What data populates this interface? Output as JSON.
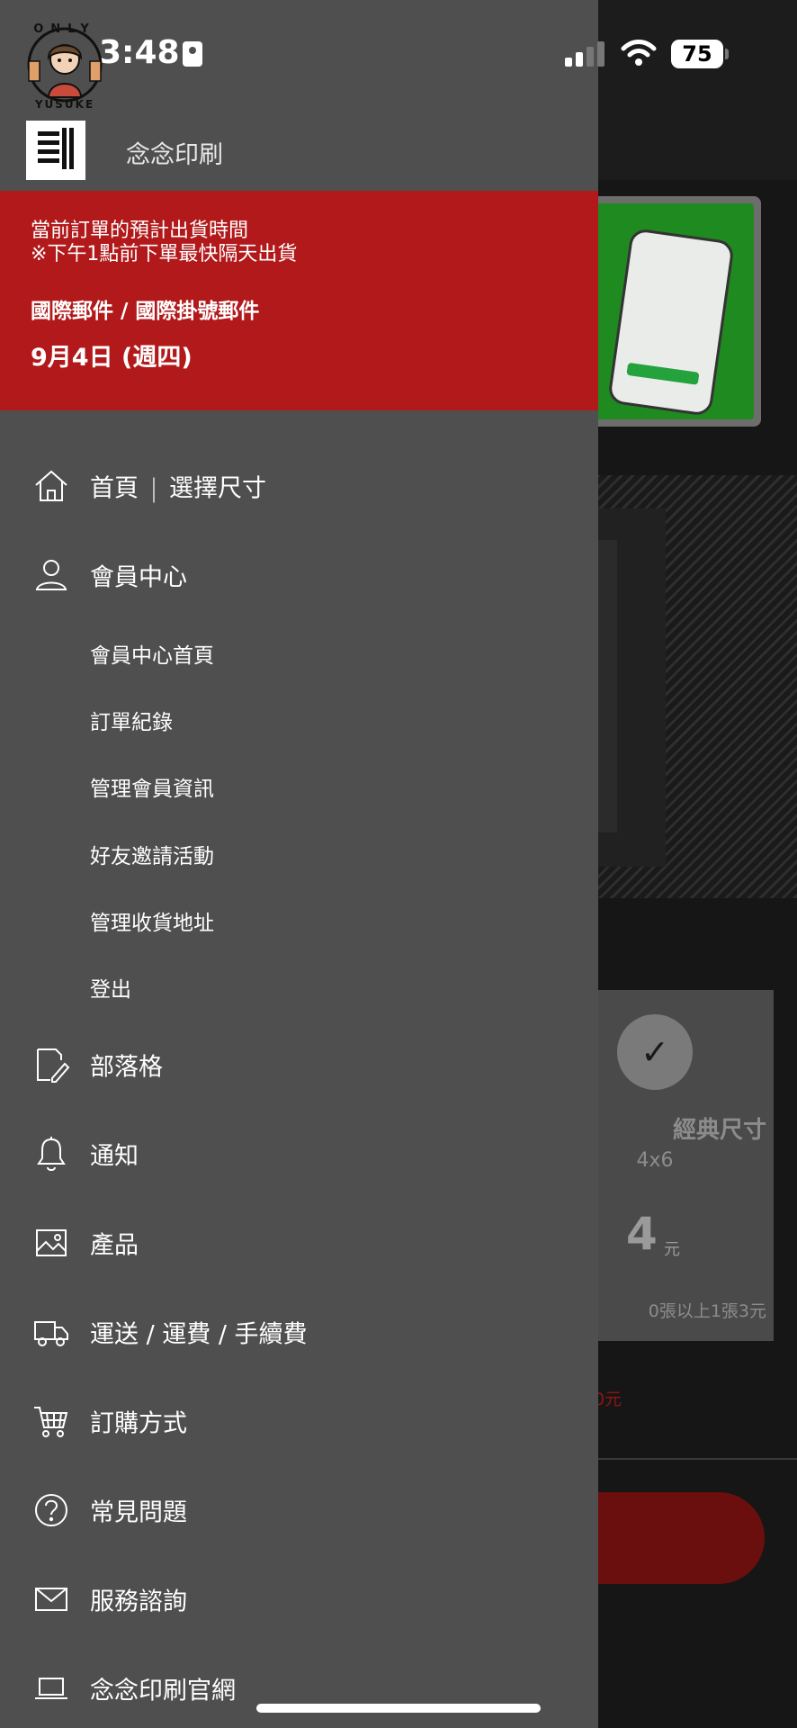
{
  "status_bar": {
    "time": "3:48",
    "battery": "75"
  },
  "watermark": {
    "top_text": "ONLY",
    "bottom_text": "YUSUKE"
  },
  "brand": {
    "name": "念念印刷"
  },
  "shipping": {
    "line1": "當前訂單的預計出貨時間",
    "line2": "※下午1點前下單最快隔天出貨",
    "method": "國際郵件 / 國際掛號郵件",
    "date": "9月4日 (週四)"
  },
  "menu": {
    "home": {
      "label_a": "首頁",
      "label_b": "選擇尺寸",
      "icon": "home-icon"
    },
    "member": {
      "label": "會員中心",
      "icon": "user-icon"
    },
    "member_sub": [
      {
        "label": "會員中心首頁"
      },
      {
        "label": "訂單紀錄"
      },
      {
        "label": "管理會員資訊"
      },
      {
        "label": "好友邀請活動"
      },
      {
        "label": "管理收貨地址"
      },
      {
        "label": "登出"
      }
    ],
    "blog": {
      "label": "部落格",
      "icon": "edit-icon"
    },
    "notice": {
      "label": "通知",
      "icon": "bell-icon"
    },
    "product": {
      "label": "產品",
      "icon": "image-icon"
    },
    "shipping": {
      "label": "運送 / 運費 / 手續費",
      "icon": "truck-icon"
    },
    "order": {
      "label": "訂購方式",
      "icon": "cart-icon"
    },
    "faq": {
      "label": "常見問題",
      "icon": "question-icon"
    },
    "contact": {
      "label": "服務諮詢",
      "icon": "mail-icon"
    },
    "website": {
      "label": "念念印刷官網",
      "icon": "laptop-icon"
    }
  },
  "background": {
    "size_title": "經典尺寸",
    "size_dim": "4x6",
    "price": "4",
    "unit": "元",
    "bulk_note": "0張以上1張3元",
    "red_note": "0元"
  },
  "colors": {
    "drawer": "#4f4f4f",
    "shipping_banner": "#b2191b",
    "backdrop": "#161616"
  }
}
